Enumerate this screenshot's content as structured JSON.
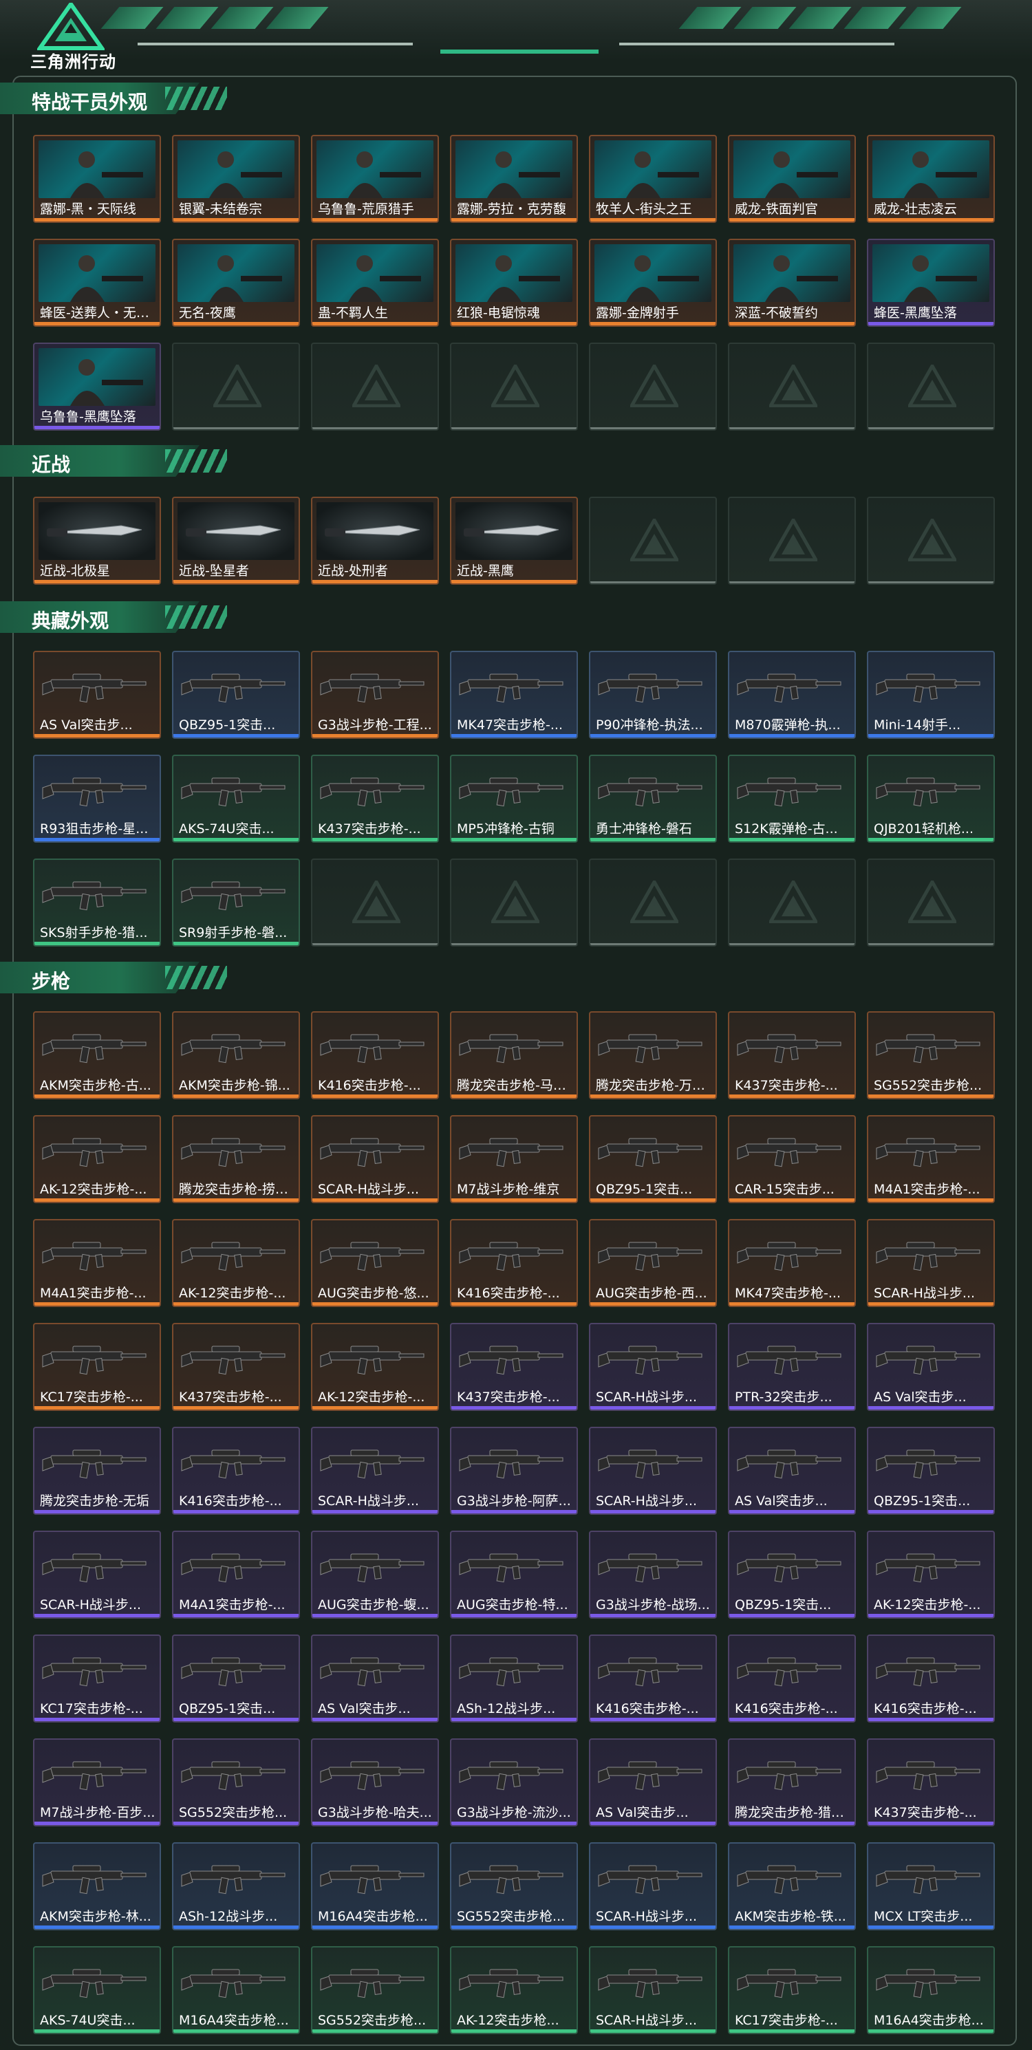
{
  "header": {
    "logo_text": "三角洲行动"
  },
  "colors": {
    "accent": "#2fb985",
    "orange": "#e9812f",
    "purple": "#7a5ae8",
    "blue": "#3c78e8",
    "green": "#3fc684"
  },
  "sections": [
    {
      "title": "特战干员外观",
      "kind": "agent",
      "items": [
        {
          "name": "露娜-黑・天际线",
          "rarity": "orange"
        },
        {
          "name": "银翼-未结卷宗",
          "rarity": "orange"
        },
        {
          "name": "乌鲁鲁-荒原猎手",
          "rarity": "orange"
        },
        {
          "name": "露娜-劳拉・克劳馥",
          "rarity": "orange"
        },
        {
          "name": "牧羊人-街头之王",
          "rarity": "orange"
        },
        {
          "name": "威龙-铁面判官",
          "rarity": "orange"
        },
        {
          "name": "威龙-壮志凌云",
          "rarity": "orange"
        },
        {
          "name": "蜂医-送葬人・无题...",
          "rarity": "orange"
        },
        {
          "name": "无名-夜鹰",
          "rarity": "orange"
        },
        {
          "name": "蛊-不羁人生",
          "rarity": "orange"
        },
        {
          "name": "红狼-电锯惊魂",
          "rarity": "orange"
        },
        {
          "name": "露娜-金牌射手",
          "rarity": "orange"
        },
        {
          "name": "深蓝-不破誓约",
          "rarity": "orange"
        },
        {
          "name": "蜂医-黑鹰坠落",
          "rarity": "purple"
        },
        {
          "name": "乌鲁鲁-黑鹰坠落",
          "rarity": "purple"
        }
      ],
      "empty_slots": 6
    },
    {
      "title": "近战",
      "kind": "melee",
      "items": [
        {
          "name": "近战-北极星",
          "rarity": "orange"
        },
        {
          "name": "近战-坠星者",
          "rarity": "orange"
        },
        {
          "name": "近战-处刑者",
          "rarity": "orange"
        },
        {
          "name": "近战-黑鹰",
          "rarity": "orange"
        }
      ],
      "empty_slots": 3
    },
    {
      "title": "典藏外观",
      "kind": "gun",
      "items": [
        {
          "name": "AS Val突击步...",
          "rarity": "orange"
        },
        {
          "name": "QBZ95-1突击...",
          "rarity": "blue"
        },
        {
          "name": "G3战斗步枪-工程...",
          "rarity": "orange"
        },
        {
          "name": "MK47突击步枪-...",
          "rarity": "blue"
        },
        {
          "name": "P90冲锋枪-执法...",
          "rarity": "blue"
        },
        {
          "name": "M870霰弹枪-执...",
          "rarity": "blue"
        },
        {
          "name": "Mini-14射手...",
          "rarity": "blue"
        },
        {
          "name": "R93狙击步枪-星...",
          "rarity": "blue"
        },
        {
          "name": "AKS-74U突击...",
          "rarity": "green"
        },
        {
          "name": "K437突击步枪-...",
          "rarity": "green"
        },
        {
          "name": "MP5冲锋枪-古铜",
          "rarity": "green"
        },
        {
          "name": "勇士冲锋枪-磐石",
          "rarity": "green"
        },
        {
          "name": "S12K霰弹枪-古...",
          "rarity": "green"
        },
        {
          "name": "QJB201轻机枪...",
          "rarity": "green"
        },
        {
          "name": "SKS射手步枪-猎...",
          "rarity": "green"
        },
        {
          "name": "SR9射手步枪-磐...",
          "rarity": "green"
        }
      ],
      "empty_slots": 5
    },
    {
      "title": "步枪",
      "kind": "gun",
      "items": [
        {
          "name": "AKM突击步枪-古...",
          "rarity": "orange"
        },
        {
          "name": "AKM突击步枪-锦...",
          "rarity": "orange"
        },
        {
          "name": "K416突击步枪-...",
          "rarity": "orange"
        },
        {
          "name": "腾龙突击步枪-马年...",
          "rarity": "orange"
        },
        {
          "name": "腾龙突击步枪-万金...",
          "rarity": "orange"
        },
        {
          "name": "K437突击步枪-...",
          "rarity": "orange"
        },
        {
          "name": "SG552突击步枪...",
          "rarity": "orange"
        },
        {
          "name": "AK-12突击步枪-...",
          "rarity": "orange"
        },
        {
          "name": "腾龙突击步枪-捞点...",
          "rarity": "orange"
        },
        {
          "name": "SCAR-H战斗步...",
          "rarity": "orange"
        },
        {
          "name": "M7战斗步枪-维京",
          "rarity": "orange"
        },
        {
          "name": "QBZ95-1突击...",
          "rarity": "orange"
        },
        {
          "name": "CAR-15突击步...",
          "rarity": "orange"
        },
        {
          "name": "M4A1突击步枪-...",
          "rarity": "orange"
        },
        {
          "name": "M4A1突击步枪-...",
          "rarity": "orange"
        },
        {
          "name": "AK-12突击步枪-...",
          "rarity": "orange"
        },
        {
          "name": "AUG突击步枪-悠...",
          "rarity": "orange"
        },
        {
          "name": "K416突击步枪-...",
          "rarity": "orange"
        },
        {
          "name": "AUG突击步枪-西...",
          "rarity": "orange"
        },
        {
          "name": "MK47突击步枪-...",
          "rarity": "orange"
        },
        {
          "name": "SCAR-H战斗步...",
          "rarity": "orange"
        },
        {
          "name": "KC17突击步枪-...",
          "rarity": "orange"
        },
        {
          "name": "K437突击步枪-...",
          "rarity": "orange"
        },
        {
          "name": "AK-12突击步枪-...",
          "rarity": "orange"
        },
        {
          "name": "K437突击步枪-...",
          "rarity": "purple"
        },
        {
          "name": "SCAR-H战斗步...",
          "rarity": "purple"
        },
        {
          "name": "PTR-32突击步...",
          "rarity": "purple"
        },
        {
          "name": "AS Val突击步...",
          "rarity": "purple"
        },
        {
          "name": "腾龙突击步枪-无垢",
          "rarity": "purple"
        },
        {
          "name": "K416突击步枪-...",
          "rarity": "purple"
        },
        {
          "name": "SCAR-H战斗步...",
          "rarity": "purple"
        },
        {
          "name": "G3战斗步枪-阿萨...",
          "rarity": "purple"
        },
        {
          "name": "SCAR-H战斗步...",
          "rarity": "purple"
        },
        {
          "name": "AS Val突击步...",
          "rarity": "purple"
        },
        {
          "name": "QBZ95-1突击...",
          "rarity": "purple"
        },
        {
          "name": "SCAR-H战斗步...",
          "rarity": "purple"
        },
        {
          "name": "M4A1突击步枪-...",
          "rarity": "purple"
        },
        {
          "name": "AUG突击步枪-蝮...",
          "rarity": "purple"
        },
        {
          "name": "AUG突击步枪-特...",
          "rarity": "purple"
        },
        {
          "name": "G3战斗步枪-战场...",
          "rarity": "purple"
        },
        {
          "name": "QBZ95-1突击...",
          "rarity": "purple"
        },
        {
          "name": "AK-12突击步枪-...",
          "rarity": "purple"
        },
        {
          "name": "KC17突击步枪-...",
          "rarity": "purple"
        },
        {
          "name": "QBZ95-1突击...",
          "rarity": "purple"
        },
        {
          "name": "AS Val突击步...",
          "rarity": "purple"
        },
        {
          "name": "ASh-12战斗步...",
          "rarity": "purple"
        },
        {
          "name": "K416突击步枪-...",
          "rarity": "purple"
        },
        {
          "name": "K416突击步枪-...",
          "rarity": "purple"
        },
        {
          "name": "K416突击步枪-...",
          "rarity": "purple"
        },
        {
          "name": "M7战斗步枪-百步...",
          "rarity": "purple"
        },
        {
          "name": "SG552突击步枪...",
          "rarity": "purple"
        },
        {
          "name": "G3战斗步枪-哈夫...",
          "rarity": "purple"
        },
        {
          "name": "G3战斗步枪-流沙...",
          "rarity": "purple"
        },
        {
          "name": "AS Val突击步...",
          "rarity": "purple"
        },
        {
          "name": "腾龙突击步枪-猎鳄...",
          "rarity": "purple"
        },
        {
          "name": "K437突击步枪-...",
          "rarity": "purple"
        },
        {
          "name": "AKM突击步枪-林...",
          "rarity": "blue"
        },
        {
          "name": "ASh-12战斗步...",
          "rarity": "blue"
        },
        {
          "name": "M16A4突击步枪...",
          "rarity": "blue"
        },
        {
          "name": "SG552突击步枪...",
          "rarity": "blue"
        },
        {
          "name": "SCAR-H战斗步...",
          "rarity": "blue"
        },
        {
          "name": "AKM突击步枪-铁...",
          "rarity": "blue"
        },
        {
          "name": "MCX LT突击步...",
          "rarity": "blue"
        },
        {
          "name": "AKS-74U突击...",
          "rarity": "green"
        },
        {
          "name": "M16A4突击步枪...",
          "rarity": "green"
        },
        {
          "name": "SG552突击步枪...",
          "rarity": "green"
        },
        {
          "name": "AK-12突击步枪...",
          "rarity": "green"
        },
        {
          "name": "SCAR-H战斗步...",
          "rarity": "green"
        },
        {
          "name": "KC17突击步枪-...",
          "rarity": "green"
        },
        {
          "name": "M16A4突击步枪...",
          "rarity": "green"
        }
      ],
      "empty_slots": 0
    }
  ]
}
